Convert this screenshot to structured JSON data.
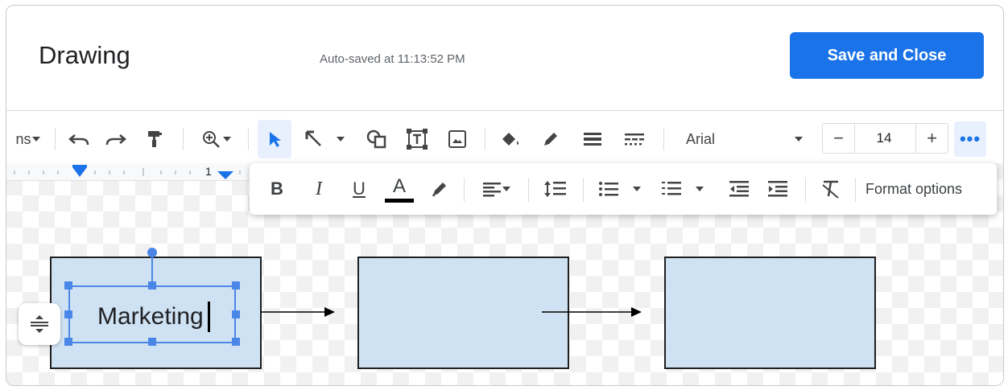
{
  "header": {
    "title": "Drawing",
    "autosave": "Auto-saved at 11:13:52 PM",
    "save_label": "Save and Close"
  },
  "toolbar": {
    "actions_partial": "ns",
    "font_name": "Arial",
    "font_size": "14",
    "minus": "−",
    "plus": "+",
    "more": "•••"
  },
  "format_bar": {
    "bold": "B",
    "italic": "I",
    "underline": "U",
    "text_color": "A",
    "format_options": "Format options"
  },
  "ruler": {
    "mark": "1"
  },
  "canvas": {
    "shape1_text": "Marketing"
  },
  "colors": {
    "accent": "#1a73e8",
    "shape_fill": "#cfe2f3",
    "selection": "#4a86e8"
  }
}
